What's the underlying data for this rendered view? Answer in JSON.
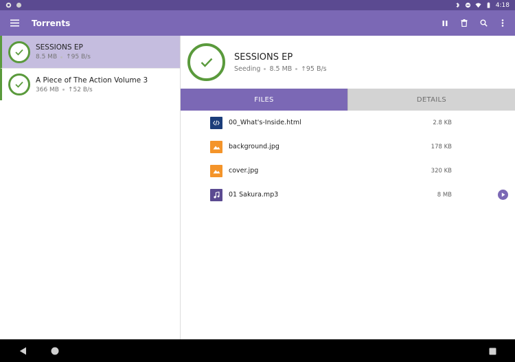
{
  "status_bar": {
    "time": "4:18"
  },
  "app_bar": {
    "title": "Torrents"
  },
  "torrents": [
    {
      "name": "SESSIONS EP",
      "size": "8.5 MB",
      "upload": "95 B/s",
      "selected": true
    },
    {
      "name": "A Piece of The Action Volume 3",
      "size": "366 MB",
      "upload": "52 B/s",
      "selected": false
    }
  ],
  "detail": {
    "name": "SESSIONS EP",
    "status": "Seeding",
    "size": "8.5 MB",
    "upload": "95 B/s"
  },
  "tabs": [
    {
      "label": "FILES",
      "active": true
    },
    {
      "label": "DETAILS",
      "active": false
    }
  ],
  "files": [
    {
      "name": "00_What's-Inside.html",
      "size": "2.8 KB",
      "icon": "code-file-icon",
      "color": "#1b3d7a"
    },
    {
      "name": "background.jpg",
      "size": "178 KB",
      "icon": "image-file-icon",
      "color": "#f4942a"
    },
    {
      "name": "cover.jpg",
      "size": "320 KB",
      "icon": "image-file-icon",
      "color": "#f4942a"
    },
    {
      "name": "01 Sakura.mp3",
      "size": "8 MB",
      "icon": "audio-file-icon",
      "color": "#5b4a91"
    }
  ],
  "colors": {
    "primary": "#7b68b5",
    "primary_dark": "#5b4a91",
    "selected_row": "#c5bddf",
    "complete": "#5a9a3c"
  }
}
